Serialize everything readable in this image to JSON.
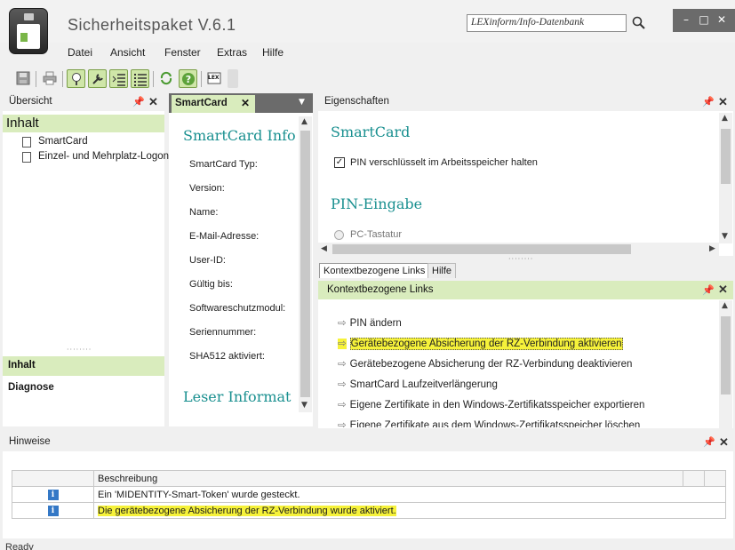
{
  "window": {
    "title": "Sicherheitspaket V.6.1",
    "search_value": "LEXinform/Info-Datenbank",
    "controls": [
      "–",
      "□",
      "✕"
    ]
  },
  "menu": [
    "Datei",
    "Ansicht",
    "Fenster",
    "Extras",
    "Hilfe"
  ],
  "toolbar": {
    "icons": [
      "save-icon",
      "print-icon",
      "tree-icon",
      "wrench-icon",
      "list-indent-icon",
      "list-icon",
      "refresh-icon",
      "help-icon",
      "lex-icon"
    ],
    "lex_label": "LEX"
  },
  "overview": {
    "title": "Übersicht",
    "section": "Inhalt",
    "items": [
      "SmartCard",
      "Einzel- und Mehrplatz-Logon"
    ],
    "nav": [
      "Inhalt",
      "Diagnose"
    ]
  },
  "smartcard_tab": {
    "tab_label": "SmartCard",
    "heading1": "SmartCard Info",
    "fields": [
      "SmartCard Typ:",
      "Version:",
      "Name:",
      "E-Mail-Adresse:",
      "User-ID:",
      "Gültig bis:",
      "Softwareschutzmodul:",
      "Seriennummer:",
      "SHA512 aktiviert:"
    ],
    "heading2": "Leser Informat"
  },
  "properties": {
    "title": "Eigenschaften",
    "heading1": "SmartCard",
    "checkbox_label": "PIN verschlüsselt im Arbeitsspeicher halten",
    "checkbox_checked": true,
    "heading2": "PIN-Eingabe",
    "radio_label": "PC-Tastatur"
  },
  "context": {
    "tabs": [
      "Kontextbezogene Links",
      "Hilfe"
    ],
    "title": "Kontextbezogene Links",
    "links": [
      "PIN ändern",
      "Gerätebezogene Absicherung der RZ-Verbindung aktivieren",
      "Gerätebezogene Absicherung der RZ-Verbindung deaktivieren",
      "SmartCard Laufzeitverlängerung",
      "Eigene Zertifikate in den Windows-Zertifikatsspeicher exportieren",
      "Eigene Zertifikate aus dem Windows-Zertifikatsspeicher löschen"
    ]
  },
  "hints": {
    "title": "Hinweise",
    "column": "Beschreibung",
    "rows": [
      "Ein 'MIDENTITY-Smart-Token' wurde gesteckt.",
      "Die gerätebezogene Absicherung der RZ-Verbindung wurde aktiviert."
    ]
  },
  "status": "Ready",
  "colors": {
    "accent_green": "#d9ecbd",
    "heading_teal": "#1a9090",
    "highlight": "#f6f23a"
  }
}
